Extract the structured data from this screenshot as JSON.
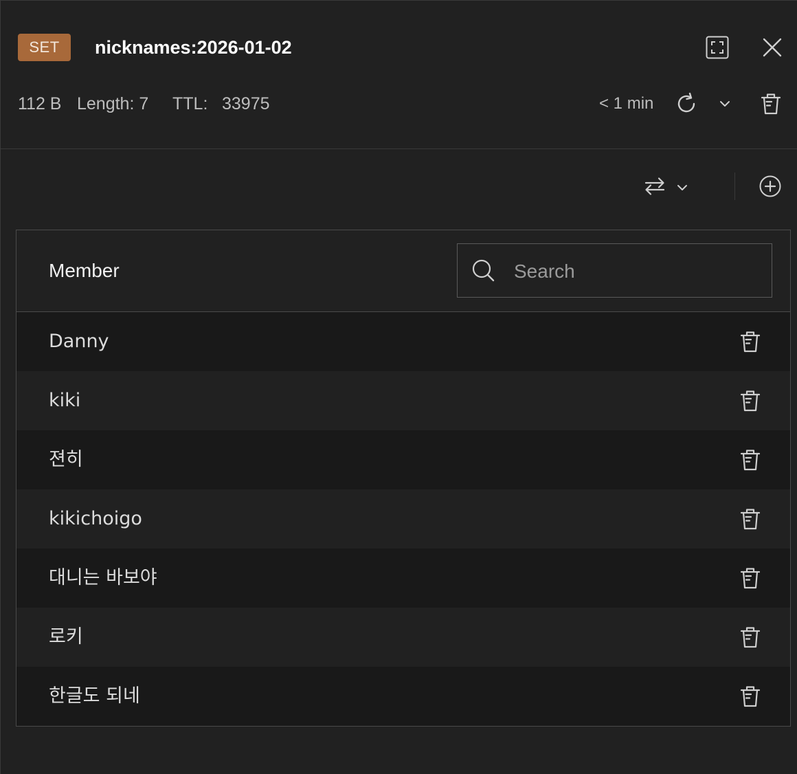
{
  "header": {
    "type_badge": "SET",
    "key_name": "nicknames:2026-01-02"
  },
  "meta": {
    "size": "112 B",
    "length_label": "Length: 7",
    "ttl_label": "TTL:",
    "ttl_value": "33975",
    "last_refresh": "< 1 min"
  },
  "table": {
    "column_title": "Member",
    "search_placeholder": "Search",
    "search_value": "",
    "members": [
      "Danny",
      "kiki",
      "젼히",
      "kikichoigo",
      "대니는 바보야",
      "로키",
      "한글도 되네"
    ]
  },
  "colors": {
    "background": "#212121",
    "row_alt": "#191919",
    "badge": "#a8693a",
    "border": "#4a4a4a"
  },
  "icons": [
    "fullscreen-icon",
    "close-icon",
    "refresh-icon",
    "chevron-down-icon",
    "trash-icon",
    "swap-icon",
    "plus-circle-icon",
    "search-icon"
  ]
}
